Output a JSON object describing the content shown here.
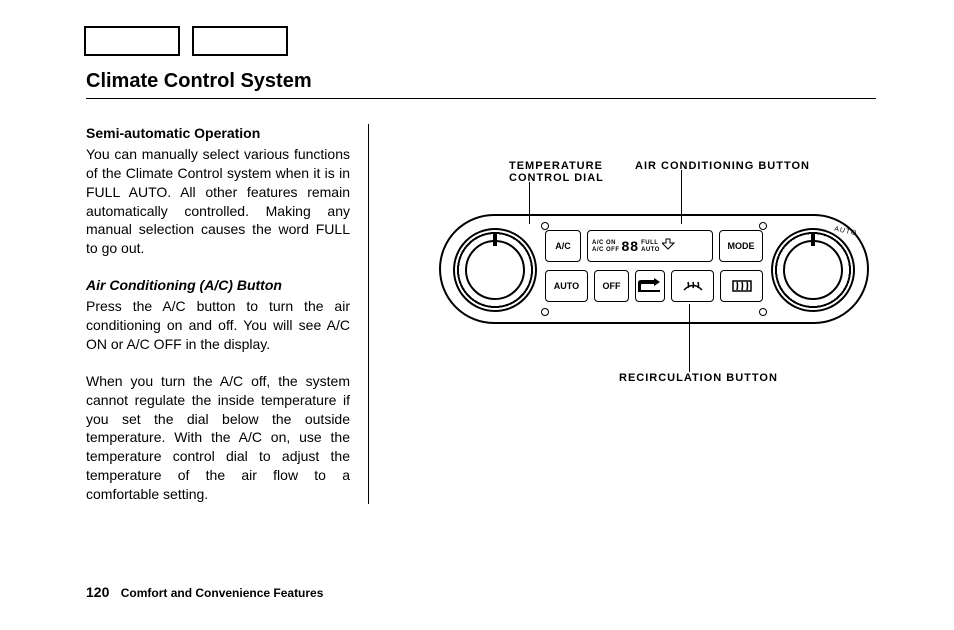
{
  "page": {
    "title": "Climate Control System",
    "page_number": "120",
    "section": "Comfort and Convenience Features"
  },
  "text": {
    "heading1": "Semi-automatic Operation",
    "para1": "You can manually select various functions of the Climate Control system when it is in FULL AUTO. All other features remain automatically controlled. Making any manual selection causes the word FULL to go out.",
    "heading2": "Air Conditioning (A/C) Button",
    "para2": "Press the A/C button to turn the air conditioning on and off. You will see A/C ON or A/C OFF in the display.",
    "para3": "When you turn the A/C off, the system cannot regulate the inside temperature if you set the dial below the outside temperature. With the A/C on, use the temperature control dial to adjust the temperature of the air flow to a comfortable setting."
  },
  "figure": {
    "labels": {
      "temperature_dial": "TEMPERATURE CONTROL DIAL",
      "ac_button": "AIR CONDITIONING BUTTON",
      "recirc_button": "RECIRCULATION BUTTON"
    },
    "panel": {
      "right_dial_arc": "AUTO",
      "display": {
        "line1_left": "A/C ON",
        "line2_left": "A/C OFF",
        "digits": "88",
        "line1_right": "FULL",
        "line2_right": "AUTO"
      },
      "buttons": {
        "ac": "A/C",
        "mode": "MODE",
        "auto": "AUTO",
        "off": "OFF"
      }
    }
  }
}
